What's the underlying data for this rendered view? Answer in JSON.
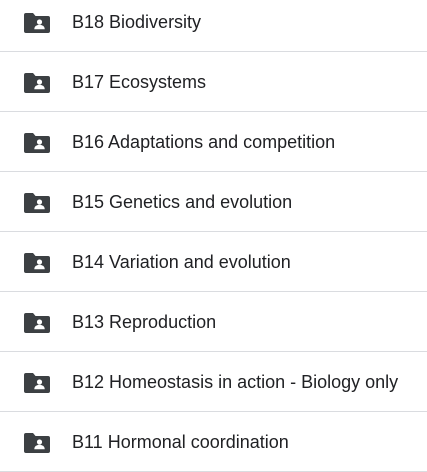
{
  "folders": [
    {
      "name": "B18 Biodiversity",
      "icon": "shared-folder-icon"
    },
    {
      "name": "B17 Ecosystems",
      "icon": "shared-folder-icon"
    },
    {
      "name": "B16 Adaptations and competition",
      "icon": "shared-folder-icon"
    },
    {
      "name": "B15 Genetics and evolution",
      "icon": "shared-folder-icon"
    },
    {
      "name": "B14 Variation and evolution",
      "icon": "shared-folder-icon"
    },
    {
      "name": "B13 Reproduction",
      "icon": "shared-folder-icon"
    },
    {
      "name": "B12 Homeostasis in action - Biology only",
      "icon": "shared-folder-icon"
    },
    {
      "name": "B11 Hormonal coordination",
      "icon": "shared-folder-icon"
    }
  ],
  "colors": {
    "icon": "#3c4043",
    "text": "#202124",
    "divider": "#dadce0"
  }
}
